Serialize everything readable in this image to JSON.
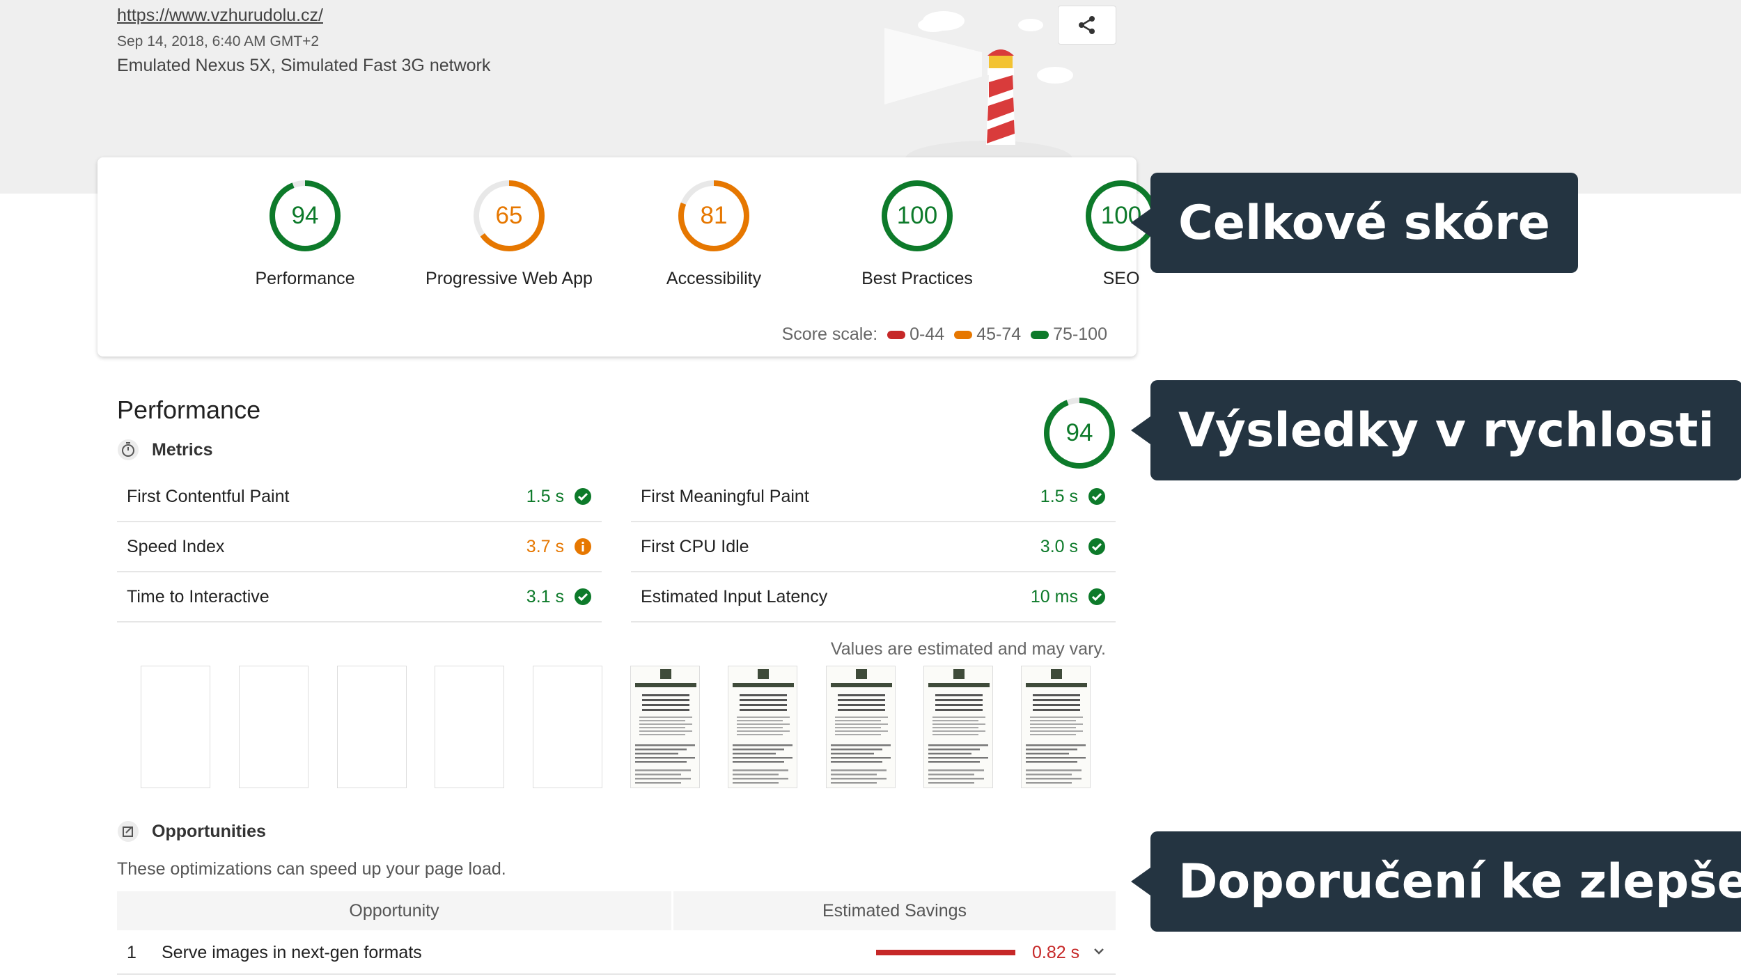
{
  "header": {
    "url": "https://www.vzhurudolu.cz/",
    "date": "Sep 14, 2018, 6:40 AM GMT+2",
    "device": "Emulated Nexus 5X, Simulated Fast 3G network"
  },
  "scores": [
    {
      "label": "Performance",
      "value": "94",
      "score": 94,
      "status": "pass"
    },
    {
      "label": "Progressive Web App",
      "value": "65",
      "score": 65,
      "status": "average"
    },
    {
      "label": "Accessibility",
      "value": "81",
      "score": 81,
      "status": "average"
    },
    {
      "label": "Best Practices",
      "value": "100",
      "score": 100,
      "status": "pass"
    },
    {
      "label": "SEO",
      "value": "100",
      "score": 100,
      "status": "pass"
    }
  ],
  "scale": {
    "label": "Score scale:",
    "fail": "0-44",
    "average": "45-74",
    "pass": "75-100"
  },
  "colors": {
    "pass": "#0d7a2a",
    "average": "#e67700",
    "fail": "#c62828",
    "callout_bg": "#243441"
  },
  "callouts": {
    "overall": "Celkové skóre",
    "speed": "Výsledky v rychlosti",
    "improvements": "Doporučení ke zlepšení"
  },
  "performance": {
    "title": "Performance",
    "score": "94",
    "score_value": 94,
    "metrics_label": "Metrics",
    "metrics": [
      {
        "name": "First Contentful Paint",
        "value": "1.5 s",
        "status": "pass"
      },
      {
        "name": "First Meaningful Paint",
        "value": "1.5 s",
        "status": "pass"
      },
      {
        "name": "Speed Index",
        "value": "3.7 s",
        "status": "average"
      },
      {
        "name": "First CPU Idle",
        "value": "3.0 s",
        "status": "pass"
      },
      {
        "name": "Time to Interactive",
        "value": "3.1 s",
        "status": "pass"
      },
      {
        "name": "Estimated Input Latency",
        "value": "10 ms",
        "status": "pass"
      }
    ],
    "note": "Values are estimated and may vary."
  },
  "opportunities": {
    "title": "Opportunities",
    "subtitle": "These optimizations can speed up your page load.",
    "col_opportunity": "Opportunity",
    "col_savings": "Estimated Savings",
    "rows": [
      {
        "num": "1",
        "title": "Serve images in next-gen formats",
        "savings": "0.82 s"
      }
    ]
  },
  "icons": {
    "share": "share-icon",
    "metrics": "stopwatch-icon",
    "opportunities": "opportunities-icon",
    "pass": "check-circle-icon",
    "average": "info-circle-icon",
    "expand": "chevron-down-icon"
  }
}
